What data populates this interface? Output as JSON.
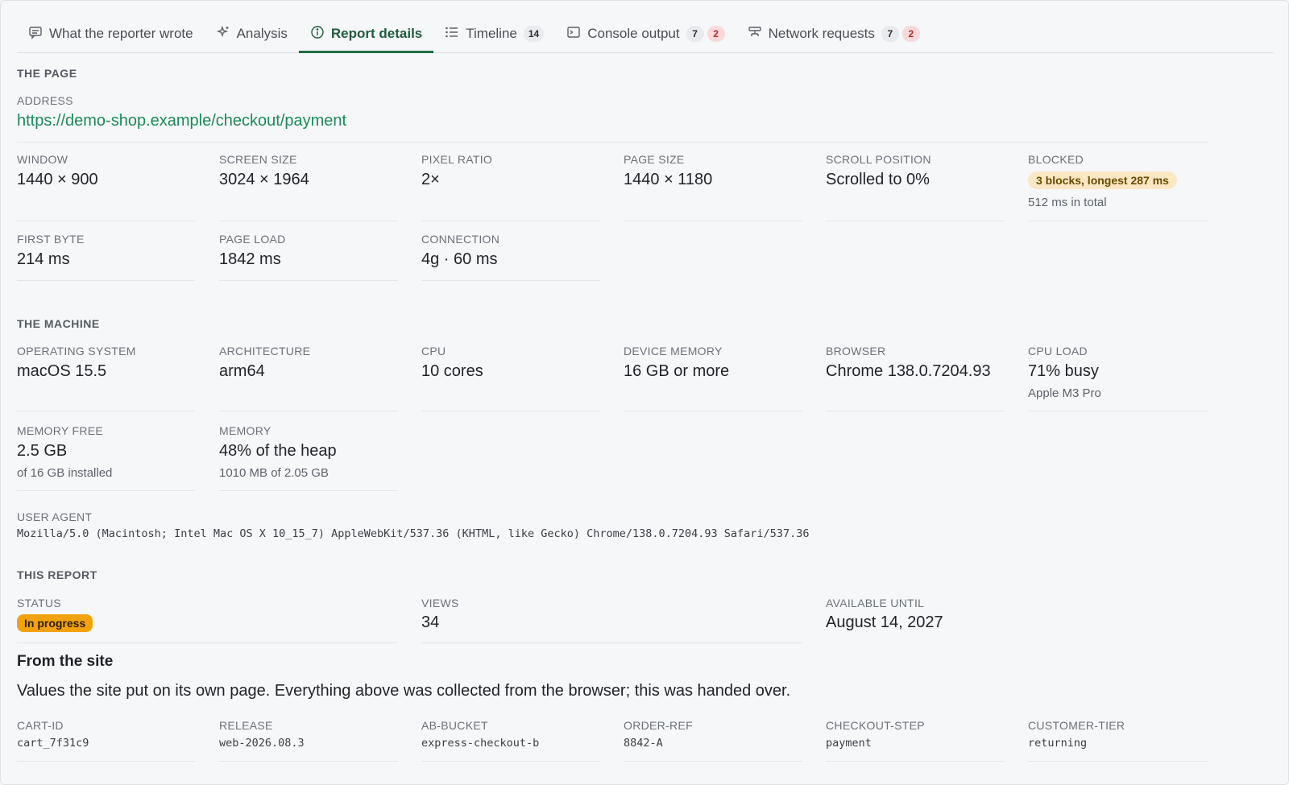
{
  "tabs": [
    {
      "label": "What the reporter wrote",
      "icon": "message-icon"
    },
    {
      "label": "Analysis",
      "icon": "sparkle-icon"
    },
    {
      "label": "Report details",
      "icon": "info-icon",
      "active": true
    },
    {
      "label": "Timeline",
      "icon": "list-icon",
      "badge": "14"
    },
    {
      "label": "Console output",
      "icon": "terminal-icon",
      "badge": "7",
      "badge_red": "2"
    },
    {
      "label": "Network requests",
      "icon": "network-icon",
      "badge": "7",
      "badge_red": "2"
    }
  ],
  "page": {
    "title": "THE PAGE",
    "address_label": "ADDRESS",
    "address": "https://demo-shop.example/checkout/payment",
    "window_label": "WINDOW",
    "window": "1440 × 900",
    "screen_label": "SCREEN SIZE",
    "screen": "3024 × 1964",
    "ratio_label": "PIXEL RATIO",
    "ratio": "2×",
    "pagesize_label": "PAGE SIZE",
    "pagesize": "1440 × 1180",
    "scroll_label": "SCROLL POSITION",
    "scroll": "Scrolled to 0%",
    "blocked_label": "BLOCKED",
    "blocked": "3 blocks, longest 287 ms",
    "blocked_sub": "512 ms in total",
    "firstbyte_label": "FIRST BYTE",
    "firstbyte": "214 ms",
    "pageload_label": "PAGE LOAD",
    "pageload": "1842 ms",
    "connection_label": "CONNECTION",
    "connection": "4g · 60 ms"
  },
  "machine": {
    "title": "THE MACHINE",
    "os_label": "OPERATING SYSTEM",
    "os": "macOS 15.5",
    "arch_label": "ARCHITECTURE",
    "arch": "arm64",
    "cpu_label": "CPU",
    "cpu": "10 cores",
    "devmem_label": "DEVICE MEMORY",
    "devmem": "16 GB or more",
    "browser_label": "BROWSER",
    "browser": "Chrome 138.0.7204.93",
    "cpuload_label": "CPU LOAD",
    "cpuload": "71% busy",
    "cpuload_sub": "Apple M3 Pro",
    "memfree_label": "MEMORY FREE",
    "memfree": "2.5 GB",
    "memfree_sub": "of 16 GB installed",
    "memory_label": "MEMORY",
    "memory": "48% of the heap",
    "memory_sub": "1010 MB of 2.05 GB",
    "ua_label": "USER AGENT",
    "ua": "Mozilla/5.0 (Macintosh; Intel Mac OS X 10_15_7) AppleWebKit/537.36 (KHTML, like Gecko) Chrome/138.0.7204.93 Safari/537.36"
  },
  "report": {
    "title": "THIS REPORT",
    "status_label": "STATUS",
    "status": "In progress",
    "views_label": "VIEWS",
    "views": "34",
    "available_label": "AVAILABLE UNTIL",
    "available": "August 14, 2027"
  },
  "site": {
    "heading": "From the site",
    "description": "Values the site put on its own page. Everything above was collected from the browser; this was handed over.",
    "fields": [
      {
        "label": "CART-ID",
        "value": "cart_7f31c9"
      },
      {
        "label": "RELEASE",
        "value": "web-2026.08.3"
      },
      {
        "label": "AB-BUCKET",
        "value": "express-checkout-b"
      },
      {
        "label": "ORDER-REF",
        "value": "8842-A"
      },
      {
        "label": "CHECKOUT-STEP",
        "value": "payment"
      },
      {
        "label": "CUSTOMER-TIER",
        "value": "returning"
      }
    ]
  },
  "colors": {
    "accent": "#1f6b47",
    "link": "#1c8a5a",
    "warning": "#f2a20c",
    "badge_red": "#f9d9d9"
  }
}
